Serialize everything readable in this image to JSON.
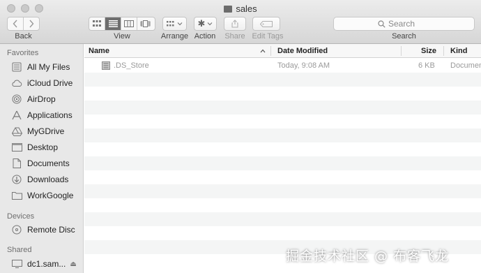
{
  "window": {
    "title": "sales"
  },
  "toolbar": {
    "back_label": "Back",
    "view_label": "View",
    "arrange_label": "Arrange",
    "action_label": "Action",
    "share_label": "Share",
    "edit_tags_label": "Edit Tags",
    "search_placeholder": "Search",
    "search_label": "Search"
  },
  "sidebar": {
    "favorites_header": "Favorites",
    "favorites": [
      {
        "label": "All My Files",
        "icon": "all-files-icon"
      },
      {
        "label": "iCloud Drive",
        "icon": "cloud-icon"
      },
      {
        "label": "AirDrop",
        "icon": "airdrop-icon"
      },
      {
        "label": "Applications",
        "icon": "applications-icon"
      },
      {
        "label": "MyGDrive",
        "icon": "google-drive-icon"
      },
      {
        "label": "Desktop",
        "icon": "desktop-icon"
      },
      {
        "label": "Documents",
        "icon": "documents-icon"
      },
      {
        "label": "Downloads",
        "icon": "downloads-icon"
      },
      {
        "label": "WorkGoogle",
        "icon": "folder-icon"
      }
    ],
    "devices_header": "Devices",
    "devices": [
      {
        "label": "Remote Disc",
        "icon": "disc-icon"
      }
    ],
    "shared_header": "Shared",
    "shared": [
      {
        "label": "dc1.sam...",
        "icon": "server-icon"
      }
    ]
  },
  "file_list": {
    "columns": {
      "name": "Name",
      "date": "Date Modified",
      "size": "Size",
      "kind": "Kind"
    },
    "rows": [
      {
        "name": ".DS_Store",
        "date": "Today, 9:08 AM",
        "size": "6 KB",
        "kind": "Documen"
      }
    ]
  },
  "watermark": "掘金技术社区 @ 布客飞龙"
}
